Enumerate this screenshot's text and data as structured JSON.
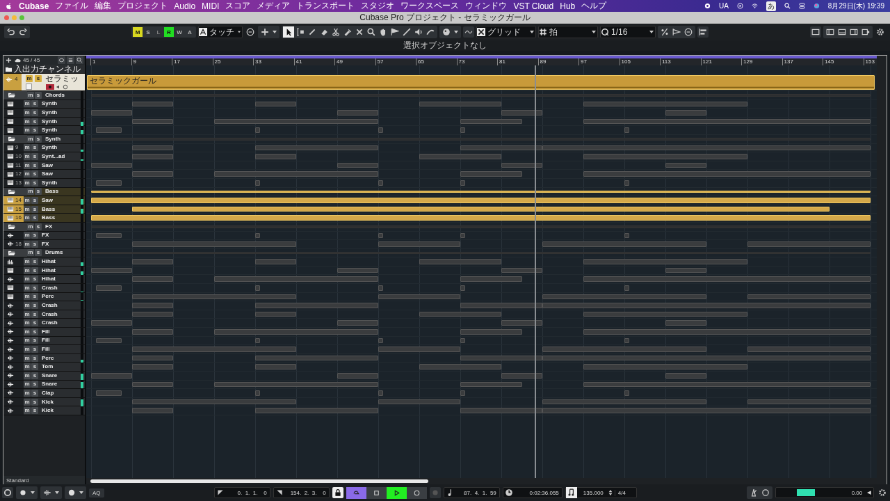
{
  "menubar": {
    "app": "Cubase",
    "items": [
      "ファイル",
      "編集",
      "プロジェクト",
      "Audio",
      "MIDI",
      "スコア",
      "メディア",
      "トランスポート",
      "スタジオ",
      "ワークスペース",
      "ウィンドウ",
      "VST Cloud",
      "Hub",
      "ヘルプ"
    ],
    "status": [
      "UA",
      "あ"
    ],
    "clock": "8月29日(木)  19:39"
  },
  "window": {
    "title": "Cubase Pro プロジェクト - セラミックガール"
  },
  "toolbar": {
    "modes": [
      {
        "label": "M",
        "on": true,
        "disabled": false,
        "color": "#d8d820"
      },
      {
        "label": "S",
        "on": false,
        "disabled": false
      },
      {
        "label": "L",
        "on": false,
        "disabled": true
      },
      {
        "label": "R",
        "on": true,
        "disabled": false,
        "color": "#22dd22"
      },
      {
        "label": "W",
        "on": false,
        "disabled": false
      },
      {
        "label": "A",
        "on": false,
        "disabled": false
      }
    ],
    "automation": "タッチ",
    "snap_type": "グリッド",
    "grid": "拍",
    "quantize": "1/16"
  },
  "info": "選択オブジェクトなし",
  "tracklist": {
    "count": "45 / 45",
    "input_folder": "入出力チャンネル",
    "audio_track": {
      "number": "4",
      "mute": "m",
      "solo": "s",
      "name": "セラミッ",
      "clip": "セラミックガール",
      "selected": true
    },
    "tracks": [
      {
        "kind": "folder",
        "name": "Chords",
        "mute": "m",
        "solo": "s",
        "selected": false,
        "children": [
          {
            "kind": "instrument",
            "name": "Synth",
            "mute": "m",
            "solo": "s",
            "selected": false
          },
          {
            "kind": "instrument",
            "name": "Synth",
            "mute": "m",
            "solo": "s",
            "selected": false
          },
          {
            "kind": "instrument",
            "name": "Synth",
            "mute": "m",
            "solo": "s",
            "selected": false,
            "level": 0.45
          },
          {
            "kind": "instrument",
            "name": "Synth",
            "mute": "m",
            "solo": "s",
            "selected": false,
            "level": 0.55
          }
        ]
      },
      {
        "kind": "folder",
        "name": "Synth",
        "mute": "m",
        "solo": "s",
        "selected": false,
        "children": [
          {
            "kind": "instrument",
            "name": "Synth",
            "number": "9",
            "mute": "m",
            "solo": "s",
            "selected": false,
            "level": 0.25
          },
          {
            "kind": "instrument",
            "name": "Synt...ad",
            "number": "10",
            "mute": "m",
            "solo": "s",
            "selected": false,
            "level": 0.2
          },
          {
            "kind": "instrument",
            "name": "Saw",
            "number": "11",
            "mute": "m",
            "solo": "s",
            "selected": false
          },
          {
            "kind": "instrument",
            "name": "Saw",
            "number": "12",
            "mute": "m",
            "solo": "s",
            "selected": false
          },
          {
            "kind": "instrument",
            "name": "Synth",
            "number": "13",
            "mute": "m",
            "solo": "s",
            "selected": false
          }
        ]
      },
      {
        "kind": "folder",
        "name": "Bass",
        "mute": "m",
        "solo": "s",
        "selected": true,
        "children": [
          {
            "kind": "instrument",
            "name": "Saw",
            "number": "14",
            "mute": "m",
            "solo": "s",
            "selected": true,
            "level": 0.7
          },
          {
            "kind": "instrument",
            "name": "Bass",
            "number": "15",
            "mute": "m",
            "solo": "s",
            "selected": true,
            "level": 0.55
          },
          {
            "kind": "instrument",
            "name": "Bass",
            "number": "16",
            "mute": "m",
            "solo": "s",
            "selected": true
          }
        ]
      },
      {
        "kind": "folder",
        "name": "FX",
        "mute": "m",
        "solo": "s",
        "selected": false,
        "children": [
          {
            "kind": "audio",
            "name": "FX",
            "mute": "m",
            "solo": "s",
            "selected": false
          },
          {
            "kind": "audio",
            "name": "FX",
            "number": "18",
            "mute": "m",
            "solo": "s",
            "selected": false
          }
        ]
      },
      {
        "kind": "folder",
        "name": "Drums",
        "mute": "m",
        "solo": "s",
        "selected": false,
        "children": [
          {
            "kind": "sampler",
            "name": "Hihat",
            "mute": "m",
            "solo": "s",
            "selected": false,
            "level": 0.45
          },
          {
            "kind": "instrument",
            "name": "Hihat",
            "mute": "m",
            "solo": "s",
            "selected": false,
            "level": 0.4
          },
          {
            "kind": "audio",
            "name": "Hihat",
            "mute": "m",
            "solo": "s",
            "selected": false
          },
          {
            "kind": "instrument",
            "name": "Crash",
            "mute": "m",
            "solo": "s",
            "selected": false,
            "level": 0.1
          },
          {
            "kind": "instrument",
            "name": "Perc",
            "mute": "m",
            "solo": "s",
            "selected": false,
            "level": 0.15
          },
          {
            "kind": "audio",
            "name": "Crash",
            "mute": "m",
            "solo": "s",
            "selected": false
          },
          {
            "kind": "audio",
            "name": "Crash",
            "mute": "m",
            "solo": "s",
            "selected": false
          },
          {
            "kind": "audio",
            "name": "Crash",
            "mute": "m",
            "solo": "s",
            "selected": false
          },
          {
            "kind": "audio",
            "name": "Fill",
            "mute": "m",
            "solo": "s",
            "selected": false
          },
          {
            "kind": "audio",
            "name": "Fill",
            "mute": "m",
            "solo": "s",
            "selected": false
          },
          {
            "kind": "audio",
            "name": "Fill",
            "mute": "m",
            "solo": "s",
            "selected": false
          },
          {
            "kind": "audio",
            "name": "Perc",
            "mute": "m",
            "solo": "s",
            "selected": false,
            "level": 0.3
          },
          {
            "kind": "audio",
            "name": "Tom",
            "mute": "m",
            "solo": "s",
            "selected": false
          },
          {
            "kind": "audio",
            "name": "Snare",
            "mute": "m",
            "solo": "s",
            "selected": false,
            "level": 0.7
          },
          {
            "kind": "audio",
            "name": "Snare",
            "mute": "m",
            "solo": "s",
            "selected": false,
            "level": 0.8
          },
          {
            "kind": "audio",
            "name": "Clap",
            "mute": "m",
            "solo": "s",
            "selected": false
          },
          {
            "kind": "audio",
            "name": "Kick",
            "mute": "m",
            "solo": "s",
            "selected": false,
            "level": 0.8
          },
          {
            "kind": "audio",
            "name": "Kick",
            "mute": "m",
            "solo": "s",
            "selected": false
          }
        ]
      }
    ]
  },
  "ruler": [
    "1",
    "9",
    "17",
    "25",
    "33",
    "41",
    "49",
    "57",
    "65",
    "73",
    "81",
    "89",
    "97",
    "105",
    "113",
    "121",
    "129",
    "137",
    "145",
    "153"
  ],
  "footer": {
    "preset": "Standard"
  },
  "transport": {
    "aq": "AQ",
    "left_locator": "0.  1.  1.    0",
    "right_locator": "154.  2.  3.    0",
    "cycle": true,
    "play": true,
    "record": false,
    "position": "87.  4.  1.  59",
    "time": "0:02:36.055",
    "tempo": "135.000",
    "signature": "4/4",
    "output": {
      "reading": "0.00",
      "level": 0.3
    }
  }
}
